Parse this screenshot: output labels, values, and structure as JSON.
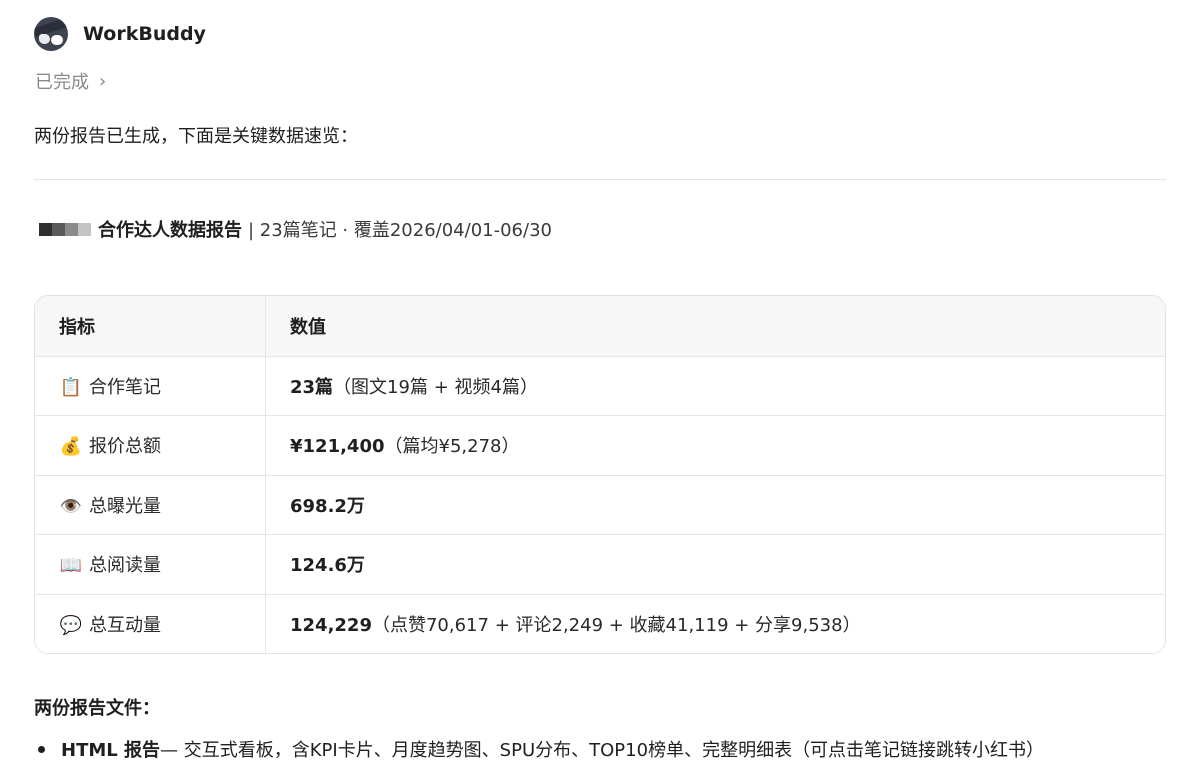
{
  "app": {
    "name": "WorkBuddy",
    "avatar_icon": "raccoon-avatar"
  },
  "status": {
    "label": "已完成"
  },
  "intro": "两份报告已生成，下面是关键数据速览：",
  "report": {
    "title_bold": "合作达人数据报告",
    "title_rest": "| 23篇笔记 · 覆盖2026/04/01-06/30"
  },
  "table": {
    "headers": [
      "指标",
      "数值"
    ],
    "rows": [
      {
        "icon": "📋",
        "icon_name": "clipboard-icon",
        "metric": "合作笔记",
        "value": "23篇",
        "detail": "（图文19篇 + 视频4篇）"
      },
      {
        "icon": "💰",
        "icon_name": "money-bag-icon",
        "metric": "报价总额",
        "value": "¥121,400",
        "detail": "（篇均¥5,278）"
      },
      {
        "icon": "👁️",
        "icon_name": "eye-icon",
        "metric": "总曝光量",
        "value": "698.2万",
        "detail": ""
      },
      {
        "icon": "📖",
        "icon_name": "open-book-icon",
        "metric": "总阅读量",
        "value": "124.6万",
        "detail": ""
      },
      {
        "icon": "💬",
        "icon_name": "speech-bubble-icon",
        "metric": "总互动量",
        "value": "124,229",
        "detail": "（点赞70,617 + 评论2,249 + 收藏41,119 + 分享9,538）"
      }
    ]
  },
  "files": {
    "title": "两份报告文件：",
    "items": [
      {
        "bold": "HTML 报告",
        "text": " — 交互式看板，含KPI卡片、月度趋势图、SPU分布、TOP10榜单、完整明细表（可点击笔记链接跳转小红书）"
      }
    ]
  }
}
